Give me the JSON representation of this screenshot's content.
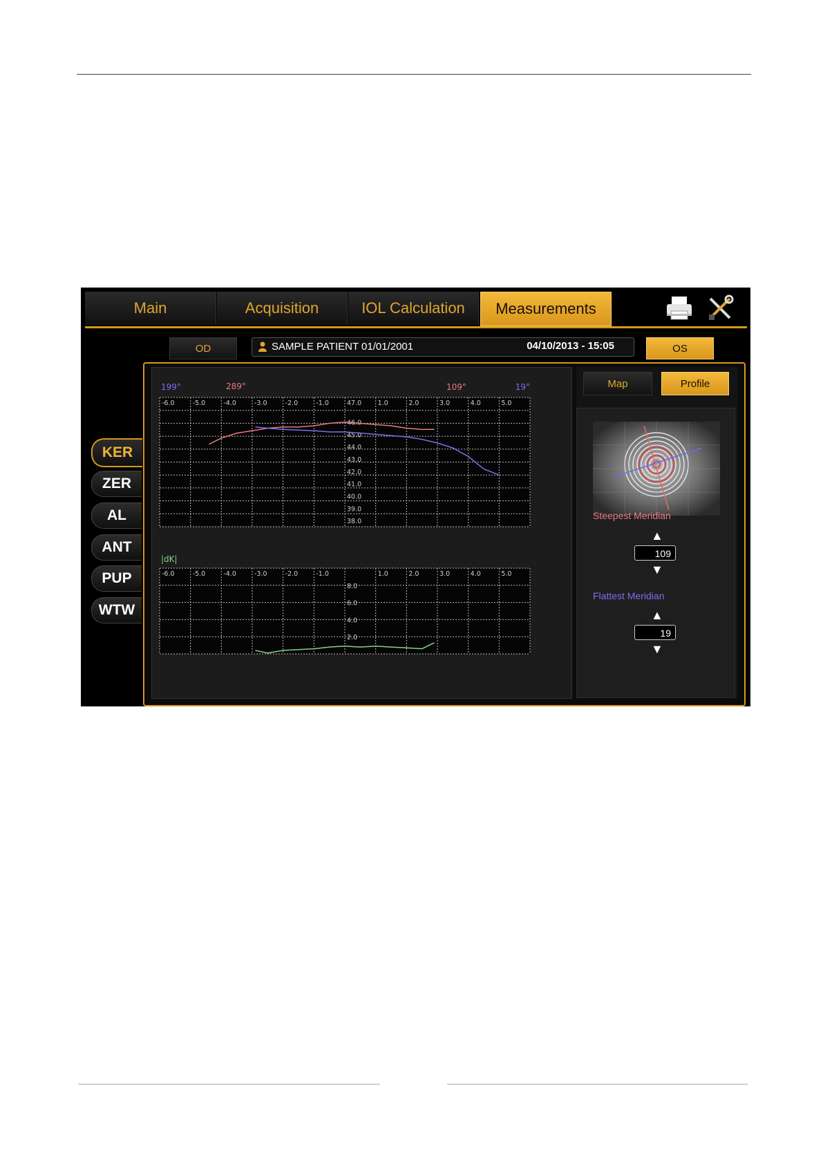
{
  "tabs": [
    {
      "label": "Main",
      "active": false
    },
    {
      "label": "Acquisition",
      "active": false
    },
    {
      "label": "IOL Calculation",
      "active": false
    },
    {
      "label": "Measurements",
      "active": true
    }
  ],
  "toolbar_icons": [
    "printer-icon",
    "tools-icon"
  ],
  "eye_buttons": {
    "od": "OD",
    "os": "OS",
    "selected": "OS"
  },
  "patient": {
    "name": "SAMPLE PATIENT 01/01/2001",
    "datetime": "04/10/2013 - 15:05"
  },
  "view_buttons": {
    "map": "Map",
    "profile": "Profile",
    "selected": "Profile"
  },
  "side_nav": [
    {
      "label": "KER",
      "active": true
    },
    {
      "label": "ZER",
      "active": false
    },
    {
      "label": "AL",
      "active": false
    },
    {
      "label": "ANT",
      "active": false
    },
    {
      "label": "PUP",
      "active": false
    },
    {
      "label": "WTW",
      "active": false
    }
  ],
  "meridians": {
    "steepest_label": "Steepest Meridian",
    "steepest_value": "109",
    "flattest_label": "Flattest Meridian",
    "flattest_value": "19"
  },
  "colors": {
    "accent": "#d8971c",
    "steep": "#e87a82",
    "flat": "#7a6ff0",
    "dk": "#7fd68a"
  },
  "chart_data": [
    {
      "type": "line",
      "title": "",
      "meridian_labels": {
        "left_flat": "199°",
        "left_steep": "289°",
        "right_steep": "109°",
        "right_flat": "19°"
      },
      "x_ticks": [
        "-6.0",
        "-5.0",
        "-4.0",
        "-3.0",
        "-2.0",
        "-1.0",
        "47.0",
        "1.0",
        "2.0",
        "3.0",
        "4.0",
        "5.0"
      ],
      "y_ticks": [
        "46.0",
        "45.0",
        "44.0",
        "43.0",
        "42.0",
        "41.0",
        "40.0",
        "39.0",
        "38.0"
      ],
      "xlim": [
        -6,
        6
      ],
      "ylim": [
        37.5,
        48
      ],
      "grid": true,
      "series": [
        {
          "name": "Steepest Meridian",
          "color": "#e87a82",
          "x": [
            -4.4,
            -4.0,
            -3.5,
            -3.0,
            -2.5,
            -2.0,
            -1.5,
            -1.0,
            -0.5,
            0.0,
            0.5,
            1.0,
            1.5,
            2.0,
            2.5,
            2.9
          ],
          "y": [
            44.2,
            44.7,
            45.1,
            45.3,
            45.5,
            45.6,
            45.6,
            45.7,
            45.9,
            46.0,
            45.9,
            45.8,
            45.7,
            45.5,
            45.4,
            45.4
          ]
        },
        {
          "name": "Flattest Meridian",
          "color": "#7a6ff0",
          "x": [
            -2.9,
            -2.5,
            -2.0,
            -1.5,
            -1.0,
            -0.5,
            0.0,
            0.5,
            1.0,
            1.5,
            2.0,
            2.5,
            3.0,
            3.5,
            4.0,
            4.5,
            5.0
          ],
          "y": [
            45.6,
            45.5,
            45.4,
            45.35,
            45.3,
            45.2,
            45.2,
            45.1,
            45.0,
            44.9,
            44.8,
            44.6,
            44.3,
            43.9,
            43.2,
            42.2,
            41.7
          ]
        }
      ]
    },
    {
      "type": "line",
      "title": "",
      "ylabel": "|dK|",
      "x_ticks": [
        "-6.0",
        "-5.0",
        "-4.0",
        "-3.0",
        "-2.0",
        "-1.0",
        "",
        "1.0",
        "2.0",
        "3.0",
        "4.0",
        "5.0"
      ],
      "y_ticks": [
        "2.0",
        "4.0",
        "6.0",
        "8.0"
      ],
      "xlim": [
        -6,
        6
      ],
      "ylim": [
        0,
        10
      ],
      "grid": true,
      "series": [
        {
          "color": "#7fd68a",
          "x": [
            -2.9,
            -2.5,
            -2.0,
            -1.5,
            -1.0,
            -0.5,
            0.0,
            0.5,
            1.0,
            1.5,
            2.0,
            2.5,
            2.9
          ],
          "y": [
            0.4,
            0.1,
            0.4,
            0.5,
            0.6,
            0.8,
            0.9,
            0.8,
            0.9,
            0.8,
            0.7,
            0.6,
            1.3
          ]
        }
      ]
    }
  ]
}
